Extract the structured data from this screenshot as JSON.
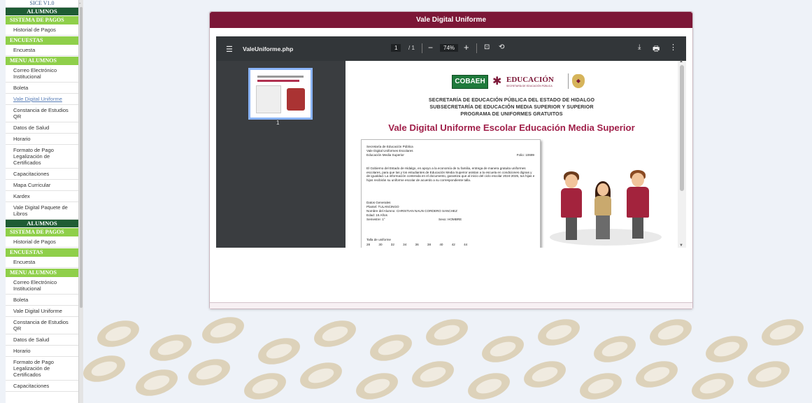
{
  "sidebar": {
    "version": "SICE V1.0",
    "dash": "-",
    "blocks": [
      {
        "title": "ALUMNOS",
        "sections": [
          {
            "title": "SISTEMA DE PAGOS",
            "items": [
              "Historial de Pagos"
            ]
          },
          {
            "title": "ENCUESTAS",
            "items": [
              "Encuesta"
            ]
          },
          {
            "title": "MENU ALUMNOS",
            "items": [
              "Correo Electrónico Institucional",
              "Boleta",
              "Vale Digital Uniforme",
              "Constancia de Estudios QR",
              "Datos de Salud",
              "Horario",
              "Formato de Pago Legalización de Certificados",
              "Capacitaciones",
              "Mapa Curricular",
              "Kardex",
              "Vale Digital Paquete de Libros"
            ]
          }
        ]
      },
      {
        "title": "ALUMNOS",
        "sections": [
          {
            "title": "SISTEMA DE PAGOS",
            "items": [
              "Historial de Pagos"
            ]
          },
          {
            "title": "ENCUESTAS",
            "items": [
              "Encuesta"
            ]
          },
          {
            "title": "MENU ALUMNOS",
            "items": [
              "Correo Electrónico Institucional",
              "Boleta",
              "Vale Digital Uniforme",
              "Constancia de Estudios QR",
              "Datos de Salud",
              "Horario",
              "Formato de Pago Legalización de Certificados",
              "Capacitaciones"
            ]
          }
        ]
      }
    ],
    "active_item": "Vale Digital Uniforme"
  },
  "panel": {
    "title": "Vale Digital Uniforme"
  },
  "viewer": {
    "filename": "ValeUniforme.php",
    "page_current": "1",
    "page_total": "/ 1",
    "zoom": "74%",
    "thumb_label": "1",
    "icons": {
      "menu": "menu-icon",
      "minus": "zoom-out-icon",
      "plus": "zoom-in-icon",
      "fit": "fit-page-icon",
      "rotate": "rotate-icon",
      "download": "download-icon",
      "print": "print-icon",
      "more": "more-vertical-icon"
    }
  },
  "document": {
    "logo_cobaeh": "COBAEH",
    "logo_educacion": "EDUCACIÓN",
    "logo_educacion_sub": "SECRETARÍA DE EDUCACIÓN PÚBLICA",
    "header1": "SECRETARÍA DE EDUCACIÓN PÚBLICA DEL ESTADO DE HIDALGO",
    "header2": "SUBSECRETARÍA DE EDUCACIÓN MEDIA SUPERIOR Y SUPERIOR",
    "header3": "PROGRAMA DE UNIFORMES GRATUITOS",
    "big_title": "Vale Digital Uniforme Escolar Educación Media Superior",
    "voucher": {
      "line1": "Secretaría de Educación Pública",
      "line2": "Vale Digital Uniformes Escolares",
      "line3": "Educación Media Superior",
      "folio": "Folio: 10699",
      "body": "El Gobierno del Estado de Hidalgo, en apoyo a la economía de tu familia, entrega de manera gratuita uniformes escolares, para que las y los estudiantes de Educación Media Superior asistan a la escuela en condiciones dignas y de igualdad. La información contenida en el documento, garantiza que al inicio del ciclo escolar 2024-2025, tus hijas e hijos recibirán su uniforme escolar de acuerdo a su correspondiente talla.",
      "general": "Datos Generales",
      "plantel": "Plantel: TULANCINGO",
      "nombre": "Nombre del Alumno: CHRISTIAN NAUN CORDERO SANCHEZ",
      "edad": "Edad: 16 Años",
      "semestre": "Semestre: 1°",
      "sexo": "Sexo: HOMBRE",
      "talla_label": "Talla de uniforme",
      "tallas": "28 30 32 34 36 38 40 42 44"
    }
  },
  "colors": {
    "header_maroon": "#7c1737",
    "sidebar_dark_green": "#1f5c34",
    "sidebar_light_green": "#8fcf4a",
    "viewer_toolbar": "#323639",
    "title_pink": "#a0204a"
  }
}
